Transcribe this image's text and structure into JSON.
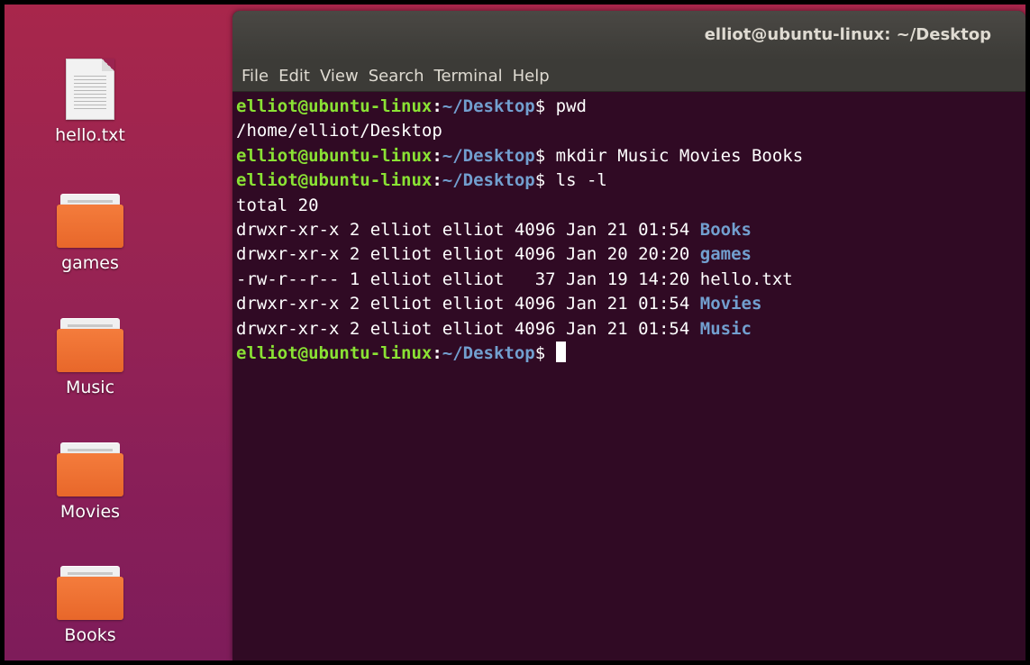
{
  "desktop": {
    "items": [
      {
        "label": "hello.txt",
        "type": "file",
        "icon": "text-file-icon"
      },
      {
        "label": "games",
        "type": "folder",
        "icon": "folder-icon"
      },
      {
        "label": "Music",
        "type": "folder",
        "icon": "folder-icon"
      },
      {
        "label": "Movies",
        "type": "folder",
        "icon": "folder-icon"
      },
      {
        "label": "Books",
        "type": "folder",
        "icon": "folder-icon"
      }
    ]
  },
  "terminal": {
    "title": "elliot@ubuntu-linux: ~/Desktop",
    "menu": [
      "File",
      "Edit",
      "View",
      "Search",
      "Terminal",
      "Help"
    ],
    "prompt": {
      "user_host": "elliot@ubuntu-linux",
      "colon": ":",
      "path": "~/Desktop",
      "sign": "$"
    },
    "colors": {
      "background": "#300a24",
      "prompt_user": "#8ae234",
      "prompt_path": "#729fcf",
      "directory": "#729fcf",
      "text": "#ffffff"
    },
    "lines": [
      {
        "kind": "command",
        "command": " pwd"
      },
      {
        "kind": "output",
        "text": "/home/elliot/Desktop"
      },
      {
        "kind": "command",
        "command": " mkdir Music Movies Books"
      },
      {
        "kind": "command",
        "command": " ls -l"
      },
      {
        "kind": "output",
        "text": "total 20"
      },
      {
        "kind": "listing",
        "prefix": "drwxr-xr-x 2 elliot elliot 4096 Jan 21 01:54 ",
        "name": "Books",
        "is_dir": true
      },
      {
        "kind": "listing",
        "prefix": "drwxr-xr-x 2 elliot elliot 4096 Jan 20 20:20 ",
        "name": "games",
        "is_dir": true
      },
      {
        "kind": "listing",
        "prefix": "-rw-r--r-- 1 elliot elliot   37 Jan 19 14:20 ",
        "name": "hello.txt",
        "is_dir": false
      },
      {
        "kind": "listing",
        "prefix": "drwxr-xr-x 2 elliot elliot 4096 Jan 21 01:54 ",
        "name": "Movies",
        "is_dir": true
      },
      {
        "kind": "listing",
        "prefix": "drwxr-xr-x 2 elliot elliot 4096 Jan 21 01:54 ",
        "name": "Music",
        "is_dir": true
      },
      {
        "kind": "command",
        "command": " ",
        "cursor": true
      }
    ]
  }
}
